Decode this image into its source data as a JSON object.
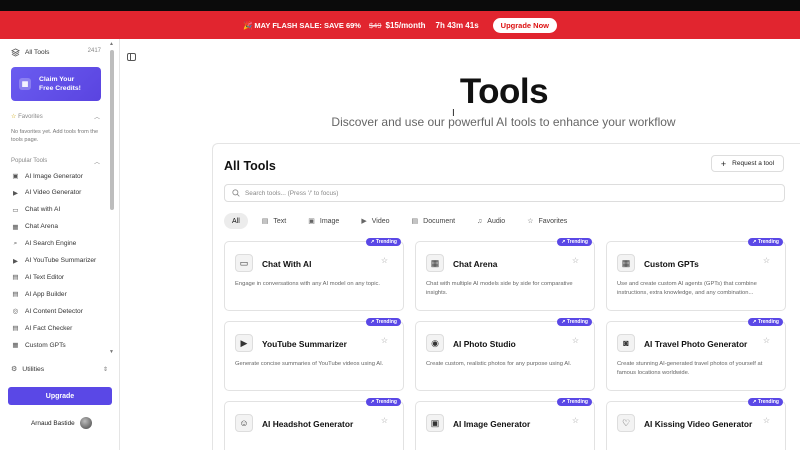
{
  "banner": {
    "text": "🎉 MAY FLASH SALE: SAVE 69%",
    "old_price": "$49",
    "price": "$15/month",
    "timer": "7h 43m 41s",
    "upgrade_label": "Upgrade Now",
    "background": "#e1252f"
  },
  "sidebar": {
    "all_tools_label": "All Tools",
    "all_tools_count": "2417",
    "claim_label": "Claim Your Free Credits!",
    "favorites_title": "Favorites",
    "favorites_empty": "No favorites yet. Add tools from the tools page.",
    "popular_title": "Popular Tools",
    "items": [
      {
        "label": "AI Image Generator",
        "icon": "image-icon"
      },
      {
        "label": "AI Video Generator",
        "icon": "video-icon"
      },
      {
        "label": "Chat with AI",
        "icon": "chat-icon"
      },
      {
        "label": "Chat Arena",
        "icon": "grid-icon"
      },
      {
        "label": "AI Search Engine",
        "icon": "search-icon"
      },
      {
        "label": "AI YouTube Summarizer",
        "icon": "youtube-icon"
      },
      {
        "label": "AI Text Editor",
        "icon": "document-icon"
      },
      {
        "label": "AI App Builder",
        "icon": "document-icon"
      },
      {
        "label": "AI Content Detector",
        "icon": "detector-icon"
      },
      {
        "label": "AI Fact Checker",
        "icon": "document-icon"
      },
      {
        "label": "Custom GPTs",
        "icon": "grid-icon"
      }
    ],
    "utilities_label": "Utilities",
    "upgrade_label": "Upgrade",
    "user_name": "Arnaud Bastide"
  },
  "page": {
    "title": "Tools",
    "subtitle": "Discover and use our powerful AI tools to enhance your workflow"
  },
  "main": {
    "heading": "All Tools",
    "request_label": "Request a tool",
    "search_placeholder": "Search tools... (Press '/' to focus)",
    "filters": [
      {
        "label": "All",
        "icon": "",
        "active": true
      },
      {
        "label": "Text",
        "icon": "text-icon",
        "active": false
      },
      {
        "label": "Image",
        "icon": "image-icon",
        "active": false
      },
      {
        "label": "Video",
        "icon": "video-icon",
        "active": false
      },
      {
        "label": "Document",
        "icon": "document-icon",
        "active": false
      },
      {
        "label": "Audio",
        "icon": "audio-icon",
        "active": false
      },
      {
        "label": "Favorites",
        "icon": "star-icon",
        "active": false
      }
    ],
    "badge_label": "Trending",
    "cards": [
      {
        "name": "Chat With AI",
        "desc": "Engage in conversations with any AI model on any topic.",
        "icon": "chat-icon"
      },
      {
        "name": "Chat Arena",
        "desc": "Chat with multiple AI models side by side for comparative insights.",
        "icon": "grid-icon"
      },
      {
        "name": "Custom GPTs",
        "desc": "Use and create custom AI agents (GPTs) that combine instructions, extra knowledge, and any combination...",
        "icon": "apps-icon"
      },
      {
        "name": "YouTube Summarizer",
        "desc": "Generate concise summaries of YouTube videos using AI.",
        "icon": "youtube-icon"
      },
      {
        "name": "AI Photo Studio",
        "desc": "Create custom, realistic photos for any purpose using AI.",
        "icon": "aperture-icon"
      },
      {
        "name": "AI Travel Photo Generator",
        "desc": "Create stunning AI-generated travel photos of yourself at famous locations worldwide.",
        "icon": "camera-icon"
      },
      {
        "name": "AI Headshot Generator",
        "desc": "",
        "icon": "person-icon"
      },
      {
        "name": "AI Image Generator",
        "desc": "",
        "icon": "image-icon"
      },
      {
        "name": "AI Kissing Video Generator",
        "desc": "",
        "icon": "heart-icon"
      }
    ]
  },
  "colors": {
    "accent": "#5a48e6",
    "sale_red": "#e1252f"
  }
}
